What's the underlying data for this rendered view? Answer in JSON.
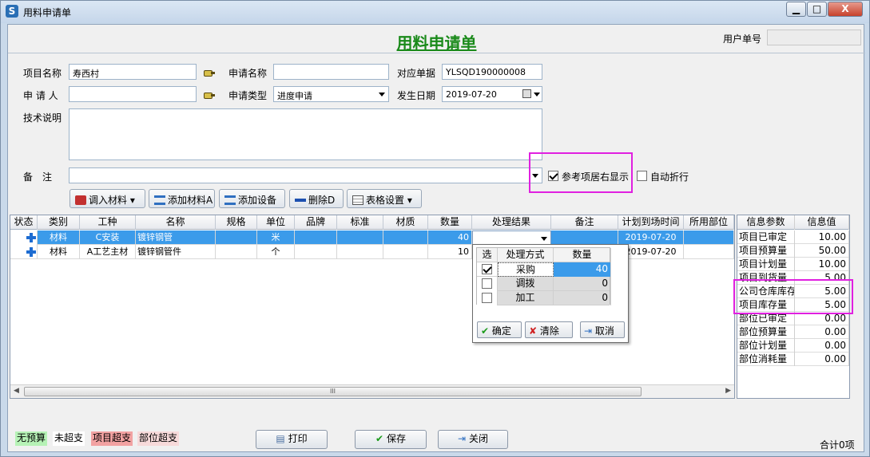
{
  "window": {
    "title": "用料申请单",
    "min_label": "▁",
    "max_label": "□",
    "close_label": "X"
  },
  "form_title": "用料申请单",
  "user_order": {
    "label": "用户单号",
    "value": ""
  },
  "fields": {
    "project_name": {
      "label": "项目名称",
      "value": "寿西村"
    },
    "request_name": {
      "label": "申请名称",
      "value": ""
    },
    "related_doc": {
      "label": "对应单据",
      "value": "YLSQD190000008"
    },
    "applicant": {
      "label": "申 请 人",
      "value": ""
    },
    "request_type": {
      "label": "申请类型",
      "value": "进度申请"
    },
    "date": {
      "label": "发生日期",
      "value": "2019-07-20"
    },
    "tech_desc": {
      "label": "技术说明",
      "value": ""
    },
    "remark": {
      "label": "备　注",
      "value": ""
    }
  },
  "options": {
    "ref_right": {
      "label": "参考项居右显示",
      "checked": true
    },
    "auto_wrap": {
      "label": "自动折行",
      "checked": false
    }
  },
  "toolbar": {
    "import": "调入材料",
    "add_material": "添加材料A",
    "add_device": "添加设备",
    "delete": "删除D",
    "table_settings": "表格设置"
  },
  "grid": {
    "columns": [
      "状态",
      "类别",
      "工种",
      "名称",
      "规格",
      "单位",
      "品牌",
      "标准",
      "材质",
      "数量",
      "处理结果",
      "备注",
      "计划到场时间",
      "所用部位"
    ],
    "rows": [
      {
        "category": "材料",
        "trade": "C安装",
        "name": "镀锌钢管",
        "spec": "",
        "unit": "米",
        "brand": "",
        "standard": "",
        "material": "",
        "qty": "40",
        "result": "",
        "remark": "",
        "arrival": "2019-07-20",
        "part": ""
      },
      {
        "category": "材料",
        "trade": "A工艺主材",
        "name": "镀锌钢管件",
        "spec": "",
        "unit": "个",
        "brand": "",
        "standard": "",
        "material": "",
        "qty": "10",
        "result": "",
        "remark": "",
        "arrival": "2019-07-20",
        "part": ""
      }
    ],
    "scroll_grip": "III"
  },
  "popup": {
    "columns": [
      "选",
      "处理方式",
      "数量"
    ],
    "rows": [
      {
        "method": "采购",
        "qty": "40",
        "checked": true
      },
      {
        "method": "调拨",
        "qty": "0",
        "checked": false
      },
      {
        "method": "加工",
        "qty": "0",
        "checked": false
      }
    ],
    "ok": "确定",
    "clear": "清除",
    "cancel": "取消"
  },
  "info": {
    "columns": [
      "信息参数",
      "信息值"
    ],
    "rows": [
      {
        "param": "项目已审定",
        "value": "10.00"
      },
      {
        "param": "项目预算量",
        "value": "50.00"
      },
      {
        "param": "项目计划量",
        "value": "10.00"
      },
      {
        "param": "项目到货量",
        "value": "5.00"
      },
      {
        "param": "公司仓库库存",
        "value": "5.00"
      },
      {
        "param": "项目库存量",
        "value": "5.00"
      },
      {
        "param": "部位已审定",
        "value": "0.00"
      },
      {
        "param": "部位预算量",
        "value": "0.00"
      },
      {
        "param": "部位计划量",
        "value": "0.00"
      },
      {
        "param": "部位消耗量",
        "value": "0.00"
      }
    ]
  },
  "legend": {
    "no_budget": "无预算",
    "not_over": "未超支",
    "project_over": "项目超支",
    "part_over": "部位超支"
  },
  "buttons": {
    "print": "打印",
    "save": "保存",
    "close": "关闭"
  },
  "total": "合计0项",
  "colors": {
    "title_green": "#1a8a1a",
    "selection": "#3b9bea",
    "highlight": "#e020e0",
    "no_budget_bg": "#b6f2b6",
    "project_over_bg": "#f2a2a2",
    "part_over_bg": "#f7dada"
  }
}
